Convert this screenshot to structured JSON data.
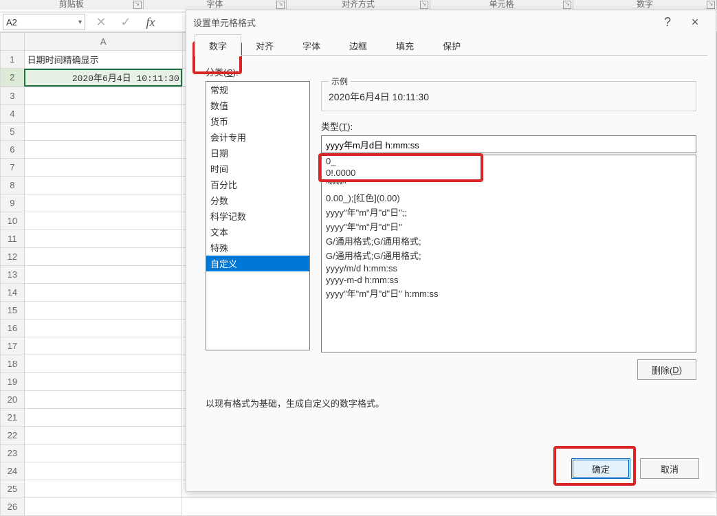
{
  "ribbon": {
    "groups": [
      "剪贴板",
      "字体",
      "对齐方式",
      "单元格",
      "数字"
    ]
  },
  "namebox": {
    "value": "A2"
  },
  "sheet": {
    "col_header_A": "A",
    "cells": {
      "A1": "日期时间精确显示",
      "A2": "2020年6月4日 10:11:30"
    },
    "row_count": 26
  },
  "dialog": {
    "title": "设置单元格格式",
    "help": "?",
    "close": "×",
    "tabs": [
      "数字",
      "对齐",
      "字体",
      "边框",
      "填充",
      "保护"
    ],
    "active_tab": 0,
    "category_label_prefix": "分类(",
    "category_label_key": "C",
    "category_label_suffix": "):",
    "categories": [
      "常规",
      "数值",
      "货币",
      "会计专用",
      "日期",
      "时间",
      "百分比",
      "分数",
      "科学记数",
      "文本",
      "特殊",
      "自定义"
    ],
    "selected_category": 11,
    "example_label": "示例",
    "example_value": "2020年6月4日 10:11:30",
    "type_label_prefix": "类型(",
    "type_label_key": "T",
    "type_label_suffix": "):",
    "type_value": "yyyy年m月d日 h:mm:ss",
    "formats": [
      "0_",
      "0!.0000",
      "\"****\"",
      "0.00_);[红色](0.00)",
      "yyyy\"年\"m\"月\"d\"日\";;",
      "yyyy\"年\"m\"月\"d\"日\"",
      "G/通用格式;G/通用格式;",
      "G/通用格式;G/通用格式;",
      "yyyy/m/d h:mm:ss",
      "yyyy-m-d h:mm:ss",
      "yyyy\"年\"m\"月\"d\"日\" h:mm:ss"
    ],
    "delete_label": "删除(",
    "delete_key": "D",
    "delete_suffix": ")",
    "note_text": "以现有格式为基础，生成自定义的数字格式。",
    "ok_label": "确定",
    "cancel_label": "取消"
  }
}
